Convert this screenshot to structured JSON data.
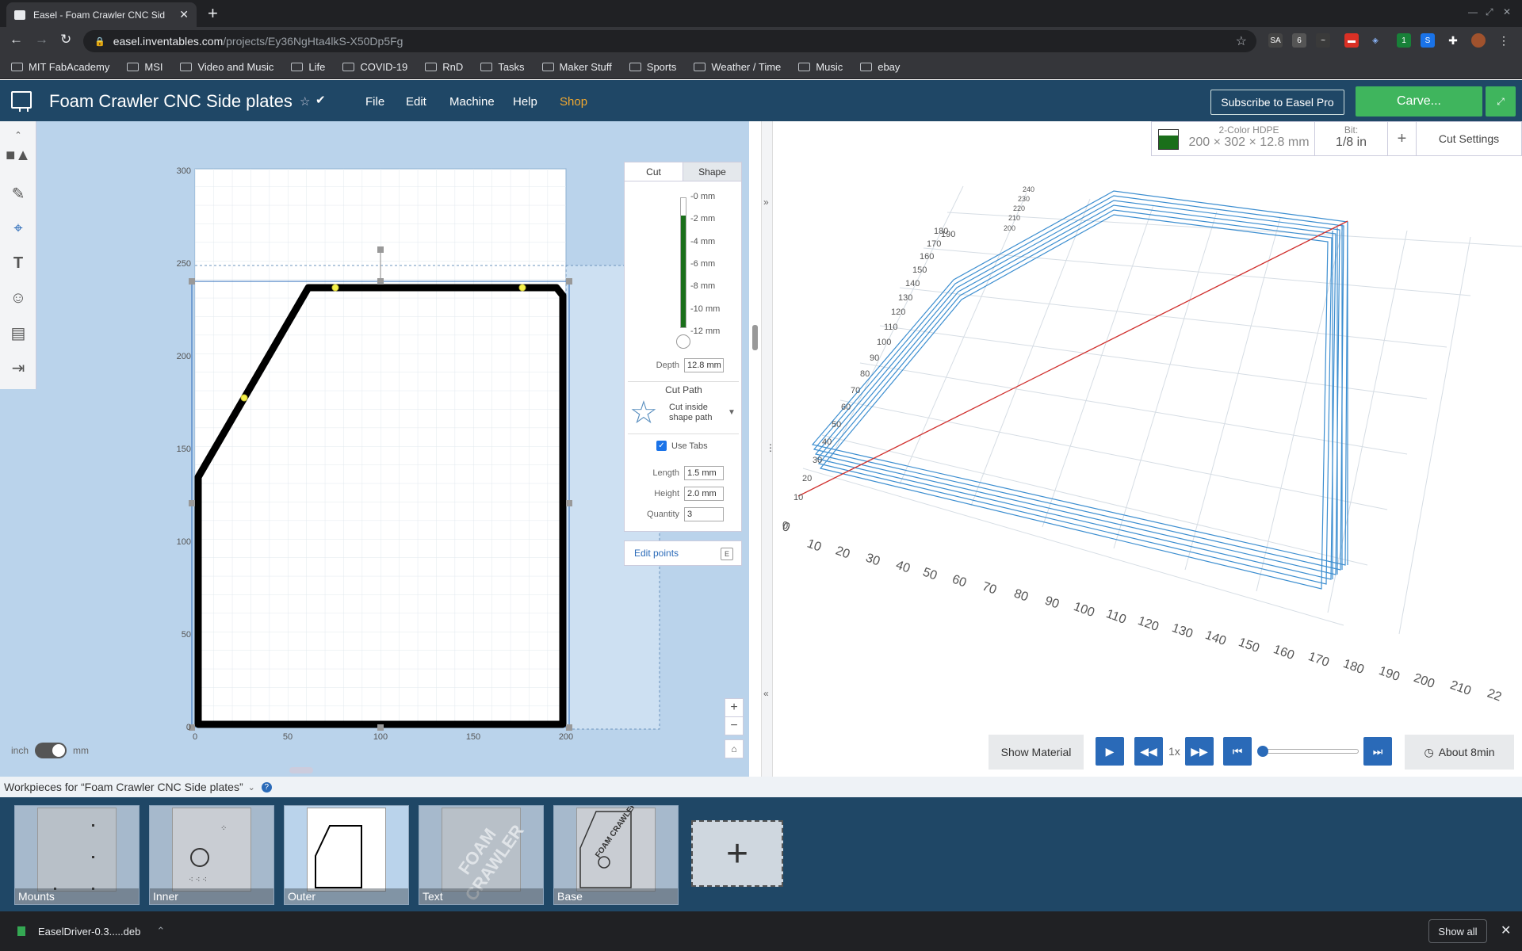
{
  "browser": {
    "tab_title": "Easel - Foam Crawler CNC Sid",
    "url_domain": "easel.inventables.com",
    "url_path": "/projects/Ey36NgHta4lkS-X50Dp5Fg",
    "bookmarks": [
      "MIT FabAcademy",
      "MSI",
      "Video and Music",
      "Life",
      "COVID-19",
      "RnD",
      "Tasks",
      "Maker Stuff",
      "Sports",
      "Weather / Time",
      "Music",
      "ebay"
    ],
    "ext_badges": {
      "sa": "SA",
      "six": "6",
      "one": "1"
    }
  },
  "app": {
    "project_title": "Foam Crawler CNC Side plates",
    "menu": {
      "file": "File",
      "edit": "Edit",
      "machine": "Machine",
      "help": "Help",
      "shop": "Shop"
    },
    "pro_button": "Subscribe to Easel Pro",
    "carve_button": "Carve...",
    "shop_color": "#f0a830",
    "accent_green": "#3fb55d",
    "header_bg": "#1f4766"
  },
  "canvas": {
    "y_ticks": [
      "300",
      "250",
      "200",
      "150",
      "100",
      "50",
      "0"
    ],
    "x_ticks": [
      "0",
      "50",
      "100",
      "150",
      "200"
    ],
    "unit_left": "inch",
    "unit_right": "mm"
  },
  "cut_panel": {
    "tab_cut": "Cut",
    "tab_shape": "Shape",
    "depth_labels": [
      "-0 mm",
      "-2 mm",
      "-4 mm",
      "-6 mm",
      "-8 mm",
      "-10 mm",
      "-12 mm"
    ],
    "depth_label": "Depth",
    "depth_value": "12.8 mm",
    "cut_path_title": "Cut Path",
    "cut_path_line1": "Cut inside",
    "cut_path_line2": "shape path",
    "use_tabs": "Use Tabs",
    "use_tabs_checked": true,
    "length_label": "Length",
    "length_value": "1.5 mm",
    "height_label": "Height",
    "height_value": "2.0 mm",
    "quantity_label": "Quantity",
    "quantity_value": "3",
    "edit_points": "Edit points",
    "edit_points_key": "E"
  },
  "material": {
    "name": "2-Color HDPE",
    "dims": "200 × 302 × 12.8 mm",
    "bit_label": "Bit:",
    "bit_value": "1/8 in",
    "plus": "+",
    "cut_settings": "Cut Settings"
  },
  "preview": {
    "x_axis": [
      "0",
      "10",
      "20",
      "30",
      "40",
      "50",
      "60",
      "70",
      "80",
      "90",
      "100",
      "110",
      "120",
      "130",
      "140",
      "150",
      "160",
      "170",
      "180",
      "190",
      "200",
      "210",
      "22"
    ],
    "y_axis": [
      "0",
      "10",
      "20",
      "30",
      "40",
      "50",
      "60",
      "70",
      "80",
      "90",
      "100",
      "110",
      "120",
      "130",
      "140",
      "150",
      "160",
      "170",
      "180",
      "190",
      "200",
      "210",
      "220",
      "230",
      "240"
    ],
    "show_material": "Show Material",
    "speed": "1x",
    "time_estimate": "About 8min",
    "playback_progress": 0
  },
  "workpieces": {
    "header": "Workpieces for “Foam Crawler CNC Side plates”",
    "items": [
      "Mounts",
      "Inner",
      "Outer",
      "Text",
      "Base"
    ],
    "text_thumb": "FOAM CRAWLER"
  },
  "downloads": {
    "file": "EaselDriver-0.3.....deb",
    "show_all": "Show all"
  }
}
